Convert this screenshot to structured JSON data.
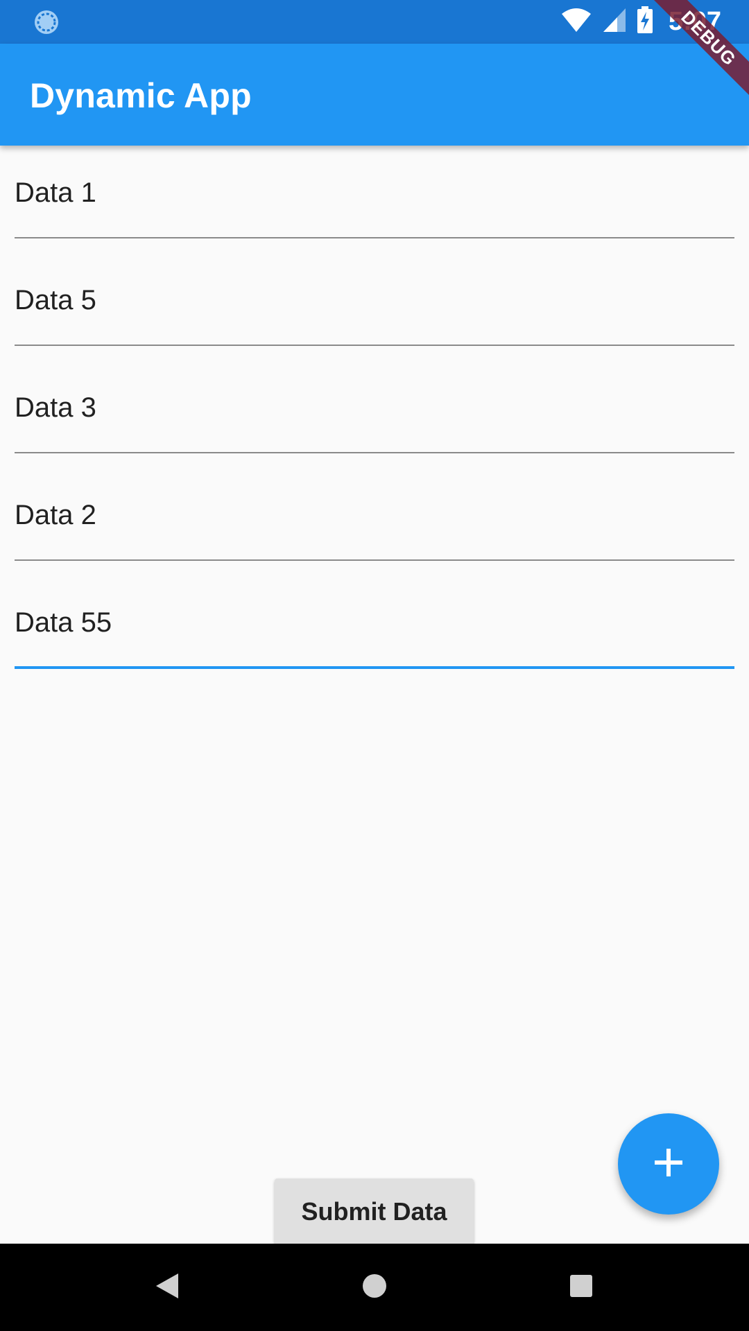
{
  "status_bar": {
    "time": "5:07",
    "left_icon": "sync-circle-icon",
    "icons": [
      "wifi-icon",
      "signal-icon",
      "battery-charging-icon"
    ],
    "background_color": "#1976d2"
  },
  "app_bar": {
    "title": "Dynamic App",
    "background_color": "#2196f3"
  },
  "debug_banner": {
    "label": "DEBUG"
  },
  "fields": [
    {
      "value": "Data 1",
      "focused": false
    },
    {
      "value": "Data 5",
      "focused": false
    },
    {
      "value": "Data 3",
      "focused": false
    },
    {
      "value": "Data 2",
      "focused": false
    },
    {
      "value": "Data 55",
      "focused": true
    }
  ],
  "submit_button": {
    "label": "Submit Data"
  },
  "fab": {
    "icon": "add-icon"
  },
  "navigation_bar": {
    "buttons": [
      "back-icon",
      "home-icon",
      "recents-icon"
    ]
  },
  "colors": {
    "accent": "#2196f3",
    "status_bar": "#1976d2",
    "background": "#fafafa"
  }
}
